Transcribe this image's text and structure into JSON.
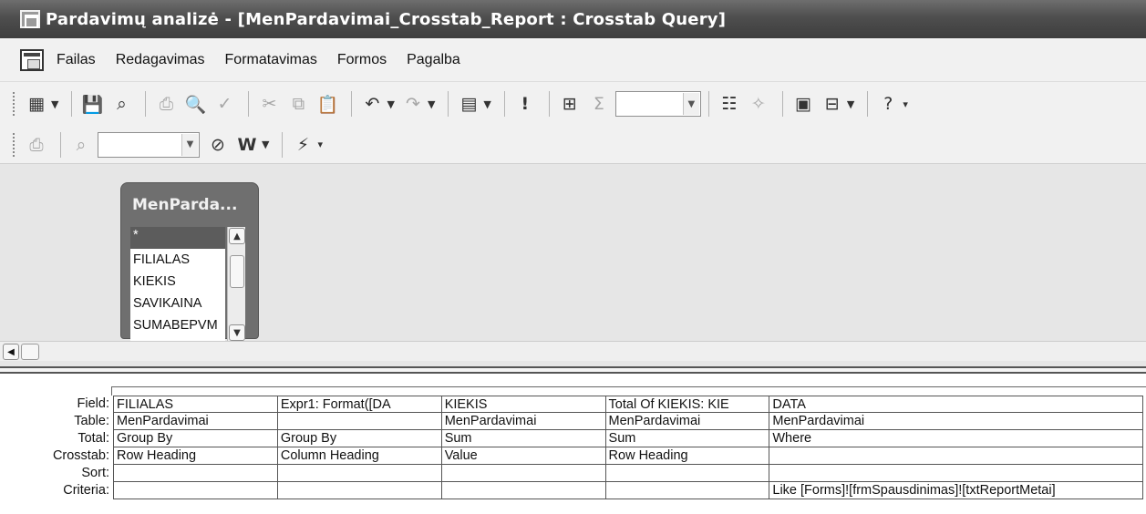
{
  "window": {
    "title": "Pardavimų analizė - [MenPardavimai_Crosstab_Report : Crosstab Query]"
  },
  "menu": {
    "items": [
      "Failas",
      "Redagavimas",
      "Formatavimas",
      "Formos",
      "Pagalba"
    ]
  },
  "toolbar1": {
    "icons": [
      "view-icon",
      "save-icon",
      "search-db-icon",
      "print-icon",
      "print-preview-icon",
      "spelling-icon",
      "cut-icon",
      "copy-icon",
      "paste-icon",
      "undo-icon",
      "redo-icon",
      "query-type-icon",
      "run-icon",
      "show-table-icon",
      "totals-icon",
      "top-values-combo",
      "properties-icon",
      "build-icon",
      "database-window-icon",
      "new-object-icon",
      "help-icon"
    ]
  },
  "toolbar2": {
    "icons": [
      "print-icon",
      "find-icon",
      "filter-combo",
      "office-links-icon",
      "word-icon",
      "run-macro-icon"
    ]
  },
  "field_list": {
    "table_title": "MenParda...",
    "fields": [
      "*",
      "FILIALAS",
      "KIEKIS",
      "SAVIKAINA",
      "SUMABEPVM"
    ]
  },
  "qbe": {
    "row_labels": [
      "Field:",
      "Table:",
      "Total:",
      "Crosstab:",
      "Sort:",
      "Criteria:"
    ],
    "columns": [
      {
        "field": "FILIALAS",
        "table": "MenPardavimai",
        "total": "Group By",
        "crosstab": "Row Heading",
        "sort": "",
        "criteria": ""
      },
      {
        "field": "Expr1: Format([DA",
        "table": "",
        "total": "Group By",
        "crosstab": "Column Heading",
        "sort": "",
        "criteria": ""
      },
      {
        "field": "KIEKIS",
        "table": "MenPardavimai",
        "total": "Sum",
        "crosstab": "Value",
        "sort": "",
        "criteria": ""
      },
      {
        "field": "Total Of KIEKIS: KIE",
        "table": "MenPardavimai",
        "total": "Sum",
        "crosstab": "Row Heading",
        "sort": "",
        "criteria": ""
      },
      {
        "field": "DATA",
        "table": "MenPardavimai",
        "total": "Where",
        "crosstab": "",
        "sort": "",
        "criteria": "Like [Forms]![frmSpausdinimas]![txtReportMetai]"
      }
    ]
  }
}
